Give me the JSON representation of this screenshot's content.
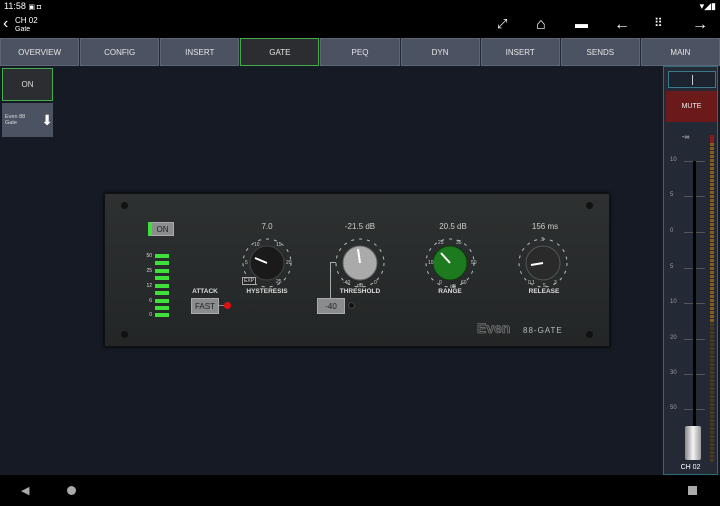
{
  "status": {
    "time": "11:58"
  },
  "header": {
    "channel": "CH 02",
    "subtitle": "Gate"
  },
  "tabs": [
    {
      "label": "OVERVIEW"
    },
    {
      "label": "CONFIG"
    },
    {
      "label": "INSERT"
    },
    {
      "label": "GATE",
      "active": true
    },
    {
      "label": "PEQ"
    },
    {
      "label": "DYN"
    },
    {
      "label": "INSERT"
    },
    {
      "label": "SENDS"
    },
    {
      "label": "MAIN"
    }
  ],
  "left": {
    "on_label": "ON",
    "preset_label": "Even 88 Gate"
  },
  "plugin": {
    "on_label": "ON",
    "meter_labels": [
      "50",
      "25",
      "12",
      "6",
      "0"
    ],
    "attack_label": "ATTACK",
    "attack_value": "FAST",
    "hysteresis": {
      "value": "7.0",
      "label": "HYSTERESIS",
      "ticks": [
        "5",
        "10",
        "15",
        "20",
        "25"
      ],
      "exp": "EXP"
    },
    "threshold": {
      "value": "-21.5 dB",
      "label": "THRESHOLD",
      "ticks": [
        "-40",
        "dB",
        "0"
      ],
      "button": "-40"
    },
    "range": {
      "value": "20.5 dB",
      "label": "RANGE",
      "ticks": [
        "0",
        "10",
        "25",
        "35",
        "50",
        "60",
        "dB"
      ]
    },
    "release": {
      "value": "156 ms",
      "label": "RELEASE",
      "ticks": [
        "0.1",
        ".5",
        "3",
        "5"
      ]
    },
    "brand": "Even",
    "model": "88-GATE"
  },
  "strip": {
    "mute": "MUTE",
    "level": "-∞",
    "scale": [
      "10",
      "5",
      "0",
      "5",
      "10",
      "20",
      "30",
      "50"
    ],
    "name": "CH 02"
  },
  "colors": {
    "accent": "#3fae4a",
    "mute": "#6b1a1a",
    "knob_range": "#1e7a1e"
  }
}
